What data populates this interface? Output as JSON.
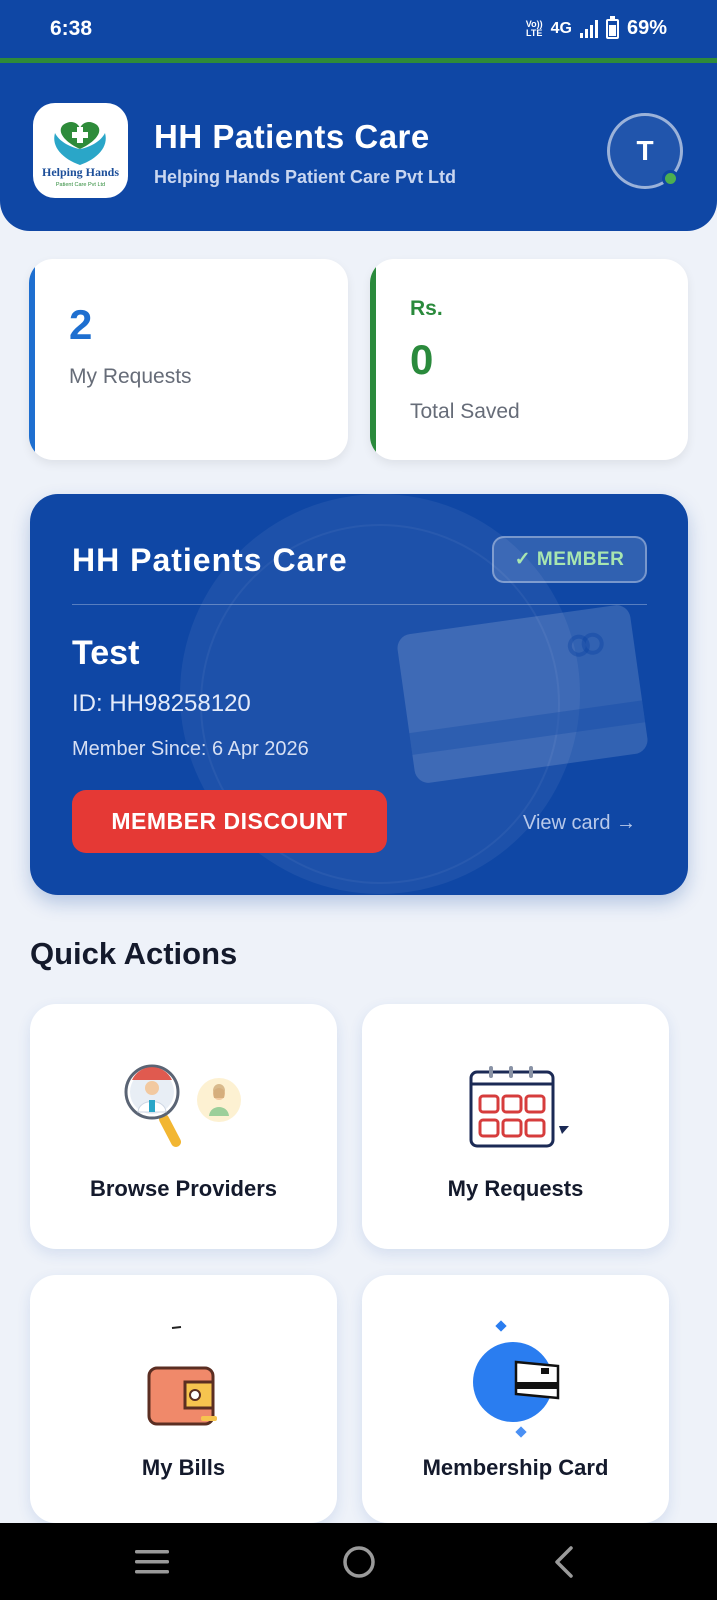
{
  "status_bar": {
    "time": "6:38",
    "volte_top": "Vo))",
    "volte_bottom": "LTE",
    "network": "4G",
    "battery": "69%"
  },
  "header": {
    "logo_text": "Helping Hands",
    "logo_subtext": "Patient Care Pvt Ltd",
    "title": "HH Patients Care",
    "subtitle": "Helping Hands Patient Care Pvt Ltd",
    "avatar_initial": "T"
  },
  "stats": {
    "requests": {
      "value": "2",
      "label": "My Requests"
    },
    "saved": {
      "currency": "Rs.",
      "value": "0",
      "label": "Total Saved"
    }
  },
  "member_card": {
    "title": "HH Patients Care",
    "badge": "✓ MEMBER",
    "name": "Test",
    "member_id": "ID: HH98258120",
    "member_since": "Member Since: 6 Apr 2026",
    "discount_button": "MEMBER DISCOUNT",
    "view_card": "View card →"
  },
  "quick_actions": {
    "title": "Quick Actions",
    "items": [
      {
        "label": "Browse Providers",
        "icon": "doctor-search-icon"
      },
      {
        "label": "My Requests",
        "icon": "calendar-icon"
      },
      {
        "label": "My Bills",
        "icon": "wallet-icon"
      },
      {
        "label": "Membership Card",
        "icon": "membership-card-icon"
      }
    ]
  },
  "colors": {
    "primary": "#0f47a5",
    "accent_green": "#2a8a3c",
    "accent_blue": "#1e6fd0",
    "danger": "#e53935"
  }
}
